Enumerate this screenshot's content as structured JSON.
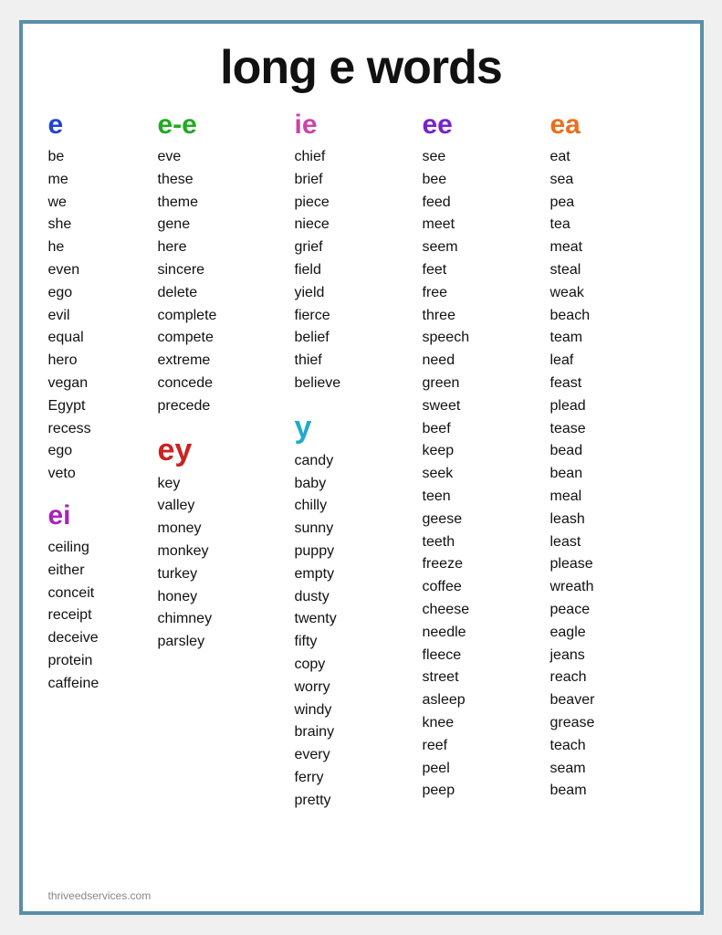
{
  "title": "long e words",
  "footer": "thriveedservices.com",
  "columns": {
    "e": {
      "header": "e",
      "words": [
        "be",
        "me",
        "we",
        "she",
        "he",
        "even",
        "ego",
        "evil",
        "equal",
        "hero",
        "vegan",
        "Egypt",
        "recess",
        "ego",
        "veto"
      ]
    },
    "ei": {
      "header": "ei",
      "words": [
        "ceiling",
        "either",
        "conceit",
        "receipt",
        "deceive",
        "protein",
        "caffeine"
      ]
    },
    "e_e": {
      "header": "e-e",
      "words": [
        "eve",
        "these",
        "theme",
        "gene",
        "here",
        "sincere",
        "delete",
        "complete",
        "compete",
        "extreme",
        "concede",
        "precede"
      ]
    },
    "ey": {
      "header": "ey",
      "words": [
        "key",
        "valley",
        "money",
        "monkey",
        "turkey",
        "honey",
        "chimney",
        "parsley"
      ]
    },
    "ie": {
      "header": "ie",
      "words": [
        "chief",
        "brief",
        "piece",
        "niece",
        "grief",
        "field",
        "yield",
        "fierce",
        "belief",
        "thief",
        "believe"
      ]
    },
    "y": {
      "header": "y",
      "words": [
        "candy",
        "baby",
        "chilly",
        "sunny",
        "puppy",
        "empty",
        "dusty",
        "twenty",
        "fifty",
        "copy",
        "worry",
        "windy",
        "brainy",
        "every",
        "ferry",
        "pretty"
      ]
    },
    "ee": {
      "header": "ee",
      "words": [
        "see",
        "bee",
        "feed",
        "meet",
        "seem",
        "feet",
        "free",
        "three",
        "speech",
        "need",
        "green",
        "sweet",
        "beef",
        "keep",
        "seek",
        "teen",
        "geese",
        "teeth",
        "freeze",
        "coffee",
        "cheese",
        "needle",
        "fleece",
        "street",
        "asleep",
        "knee",
        "reef",
        "peel",
        "peep"
      ]
    },
    "ea": {
      "header": "ea",
      "words": [
        "eat",
        "sea",
        "pea",
        "tea",
        "meat",
        "steal",
        "weak",
        "beach",
        "team",
        "leaf",
        "feast",
        "plead",
        "tease",
        "bead",
        "bean",
        "meal",
        "leash",
        "least",
        "please",
        "wreath",
        "peace",
        "eagle",
        "jeans",
        "reach",
        "beaver",
        "grease",
        "teach",
        "seam",
        "beam"
      ]
    }
  }
}
